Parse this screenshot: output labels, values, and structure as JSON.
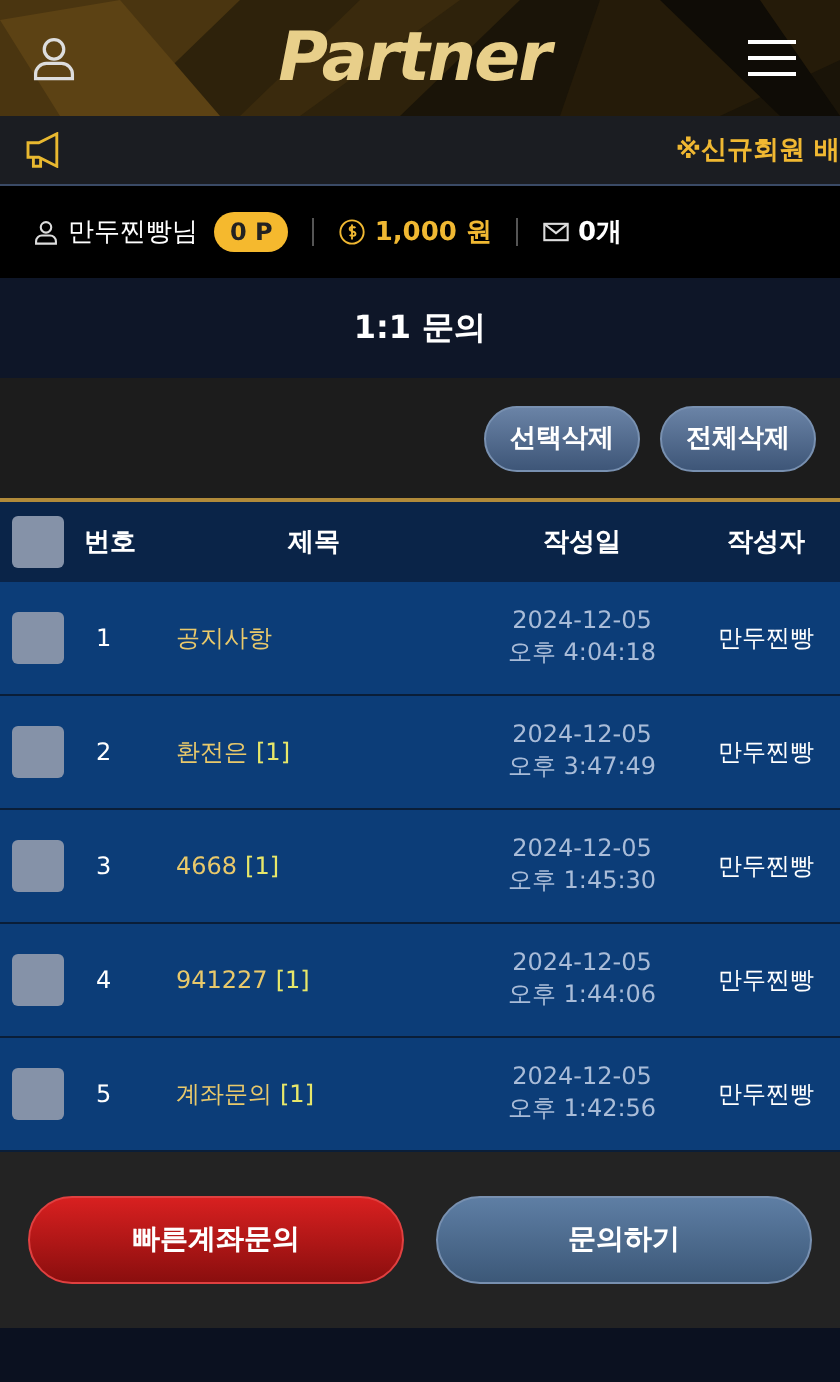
{
  "header": {
    "logo": "Partner"
  },
  "notice": {
    "text": "※신규회원 배"
  },
  "user_bar": {
    "name": "만두찐빵님",
    "points": "0 P",
    "money": "1,000 원",
    "messages": "0개"
  },
  "page_title": "1:1 문의",
  "actions": [
    "선택삭제",
    "전체삭제"
  ],
  "table": {
    "select_all": {
      "checked": false
    },
    "columns": [
      "번호",
      "제목",
      "작성일",
      "작성자"
    ],
    "rows": [
      {
        "checked": false,
        "number": "1",
        "title": "공지사항",
        "date": "2024-12-05",
        "time": "오후 4:04:18",
        "author": "만두찐빵"
      },
      {
        "checked": false,
        "number": "2",
        "title": "환전은",
        "replies": "[1]",
        "date": "2024-12-05",
        "time": "오후 3:47:49",
        "author": "만두찐빵"
      },
      {
        "checked": false,
        "number": "3",
        "title": "4668",
        "replies": "[1]",
        "date": "2024-12-05",
        "time": "오후 1:45:30",
        "author": "만두찐빵"
      },
      {
        "checked": false,
        "number": "4",
        "title": "941227",
        "replies": "[1]",
        "date": "2024-12-05",
        "time": "오후 1:44:06",
        "author": "만두찐빵"
      },
      {
        "checked": false,
        "number": "5",
        "title": "계좌문의",
        "replies": "[1]",
        "date": "2024-12-05",
        "time": "오후 1:42:56",
        "author": "만두찐빵"
      }
    ]
  },
  "bottom_buttons": [
    {
      "label": "빠른계좌문의",
      "kind": "primary"
    },
    {
      "label": "문의하기",
      "kind": "secondary"
    }
  ]
}
